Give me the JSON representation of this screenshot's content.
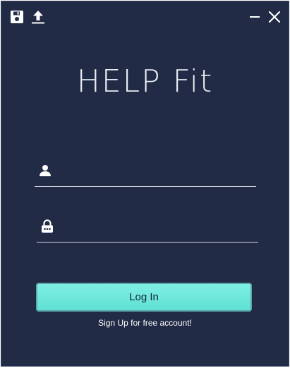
{
  "app": {
    "title": "HELP Fit"
  },
  "toolbar": {
    "icons": [
      "floppy-disk-icon",
      "upload-icon",
      "minimize-icon",
      "close-icon"
    ]
  },
  "form": {
    "username": {
      "icon": "user-icon",
      "value": "",
      "placeholder": ""
    },
    "password": {
      "icon": "lock-icon",
      "value": "",
      "placeholder": ""
    },
    "login_label": "Log In",
    "signup_label": "Sign Up for free account!"
  },
  "colors": {
    "background": "#212b45",
    "button": "#6ce8da",
    "text": "#e9edf3"
  }
}
